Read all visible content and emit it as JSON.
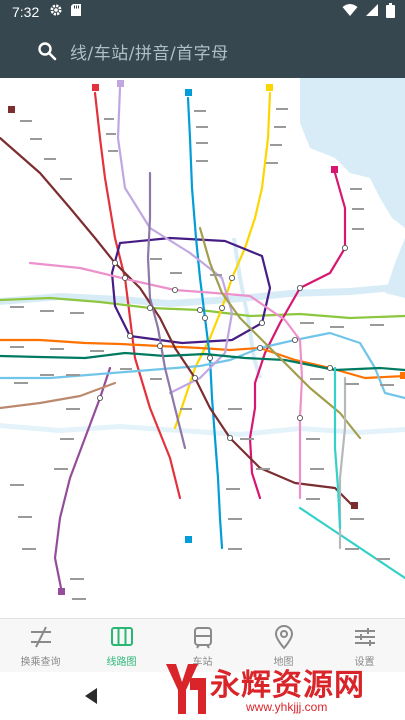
{
  "status_bar": {
    "time": "7:32",
    "left_icons": [
      "gear-icon",
      "sd-card-icon"
    ],
    "right_icons": [
      "wifi-icon",
      "signal-icon",
      "battery-icon"
    ]
  },
  "search": {
    "placeholder": "线/车站/拼音/首字母",
    "icon": "search-icon"
  },
  "map": {
    "background_color": "#ffffff",
    "water_color": "#d8ecf8",
    "line_colors": [
      "#e3323b",
      "#8dc63f",
      "#fcd600",
      "#461d84",
      "#944d9a",
      "#d71671",
      "#ff7200",
      "#009dd9",
      "#71c5e8",
      "#c1a7e2",
      "#7c2d2f",
      "#007a60",
      "#ec91cc",
      "#b6b8ba",
      "#32d2ca",
      "#a19e4d",
      "#8e77a9",
      "#bb8a6e"
    ]
  },
  "bottom_nav": {
    "items": [
      {
        "label": "换乘查询",
        "icon": "transfer-icon",
        "active": false
      },
      {
        "label": "线路图",
        "icon": "map-book-icon",
        "active": true
      },
      {
        "label": "车站",
        "icon": "station-icon",
        "active": false
      },
      {
        "label": "地图",
        "icon": "location-pin-icon",
        "active": false
      },
      {
        "label": "设置",
        "icon": "settings-sliders-icon",
        "active": false
      }
    ],
    "active_color": "#2bb673",
    "inactive_color": "#8a8a8a"
  },
  "watermark": {
    "title": "永辉资源网",
    "url": "www.yhkjjj.com",
    "color": "#d9252a"
  }
}
